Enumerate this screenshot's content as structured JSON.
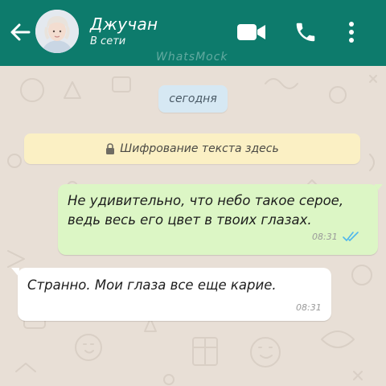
{
  "header": {
    "contact_name": "Джучан",
    "status": "В сети",
    "watermark": "WhatsMock",
    "background_color": "#0d7b6c",
    "icons": [
      "back-arrow-icon",
      "video-call-icon",
      "phone-icon",
      "more-vert-icon"
    ]
  },
  "chat": {
    "date_label": "сегодня",
    "encryption_notice": "Шифрование текста здесь",
    "messages": [
      {
        "direction": "outgoing",
        "lines": [
          "Не удивительно, что небо такое серое,",
          "ведь весь его цвет в твоих глазах."
        ],
        "time": "08:31",
        "read": true
      },
      {
        "direction": "incoming",
        "lines": [
          "Странно. Мои глаза все еще карие."
        ],
        "time": "08:31"
      }
    ]
  },
  "colors": {
    "outgoing_bubble": "#dcf6c5",
    "incoming_bubble": "#ffffff",
    "read_ticks": "#4fb6ec",
    "date_chip": "#d6e8f3",
    "encryption_banner": "#fbf0c4"
  }
}
